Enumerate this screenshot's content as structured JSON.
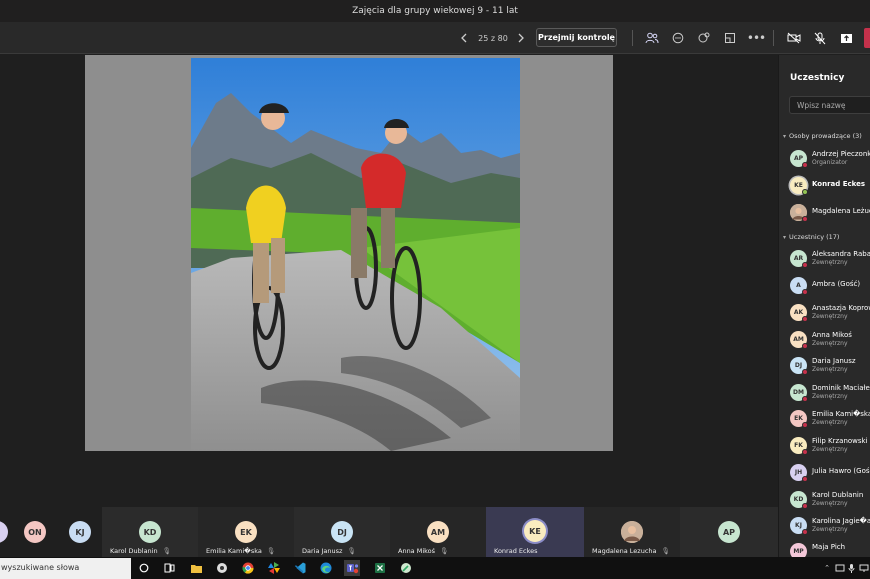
{
  "window": {
    "title": "Zajęcia dla grupy wiekowej 9 - 11 lat"
  },
  "toolbar": {
    "page_counter": "25 z 80",
    "take_control_label": "Przejmij kontrolę"
  },
  "gallery": {
    "tiles": [
      {
        "initials": "ON",
        "name": "",
        "color": "#f4c7c3"
      },
      {
        "initials": "KJ",
        "name": "",
        "color": "#c9ddf3"
      },
      {
        "initials": "KD",
        "name": "Karol Dublanin",
        "color": "#c7e6d0"
      },
      {
        "initials": "EK",
        "name": "Emilia Kami�ska",
        "color": "#f9e0c2"
      },
      {
        "initials": "DJ",
        "name": "Daria Janusz",
        "color": "#c9e4f5"
      },
      {
        "initials": "AM",
        "name": "Anna Mikoś",
        "color": "#f9e0c2"
      },
      {
        "initials": "KE",
        "name": "Konrad Eckes",
        "color": "#f9ecc0"
      },
      {
        "initials": "",
        "name": "Magdalena Lezucha",
        "color": "#d9c3b3"
      },
      {
        "initials": "AP",
        "name": "",
        "color": "#c7e6d0"
      }
    ]
  },
  "sidebar": {
    "title": "Uczestnicy",
    "search_placeholder": "Wpisz nazwę",
    "presenters_header": "Osoby prowadzące (3)",
    "presenters": [
      {
        "initials": "AP",
        "name": "Andrzej Pieczonka",
        "role": "Organizator",
        "color": "#c7e6d0"
      },
      {
        "initials": "KE",
        "name": "Konrad Eckes",
        "role": "",
        "color": "#f9ecc0"
      },
      {
        "initials": "",
        "name": "Magdalena Leżuch",
        "role": "",
        "color": "#d9c3b3"
      }
    ],
    "attendees_header": "Uczestnicy (17)",
    "attendees": [
      {
        "initials": "AR",
        "name": "Aleksandra Raba",
        "role": "Zewnętrzny",
        "color": "#c7e6d0"
      },
      {
        "initials": "A",
        "name": "Ambra (Gość)",
        "role": "",
        "color": "#c9ddf3"
      },
      {
        "initials": "AK",
        "name": "Anastazja Koprow",
        "role": "Zewnętrzny",
        "color": "#f9e0c2"
      },
      {
        "initials": "AM",
        "name": "Anna Mikoś",
        "role": "Zewnętrzny",
        "color": "#f9e0c2"
      },
      {
        "initials": "DJ",
        "name": "Daria Janusz",
        "role": "Zewnętrzny",
        "color": "#c9e4f5"
      },
      {
        "initials": "DM",
        "name": "Dominik Maciałek",
        "role": "Zewnętrzny",
        "color": "#c7e6d0"
      },
      {
        "initials": "EK",
        "name": "Emilia Kami�ska",
        "role": "Zewnętrzny",
        "color": "#f4c7c3"
      },
      {
        "initials": "FK",
        "name": "Filip Krzanowski",
        "role": "Zewnętrzny",
        "color": "#f9ecc0"
      },
      {
        "initials": "JH",
        "name": "Julia Hawro (Gość)",
        "role": "",
        "color": "#d8d0f0"
      },
      {
        "initials": "KD",
        "name": "Karol Dublanin",
        "role": "Zewnętrzny",
        "color": "#c7e6d0"
      },
      {
        "initials": "KJ",
        "name": "Karolina Jagie�a",
        "role": "Zewnętrzny",
        "color": "#c9ddf3"
      },
      {
        "initials": "MP",
        "name": "Maja Pich",
        "role": "",
        "color": "#f4c7d8"
      }
    ]
  },
  "taskbar": {
    "search_text": "wyszukiwane słowa"
  }
}
